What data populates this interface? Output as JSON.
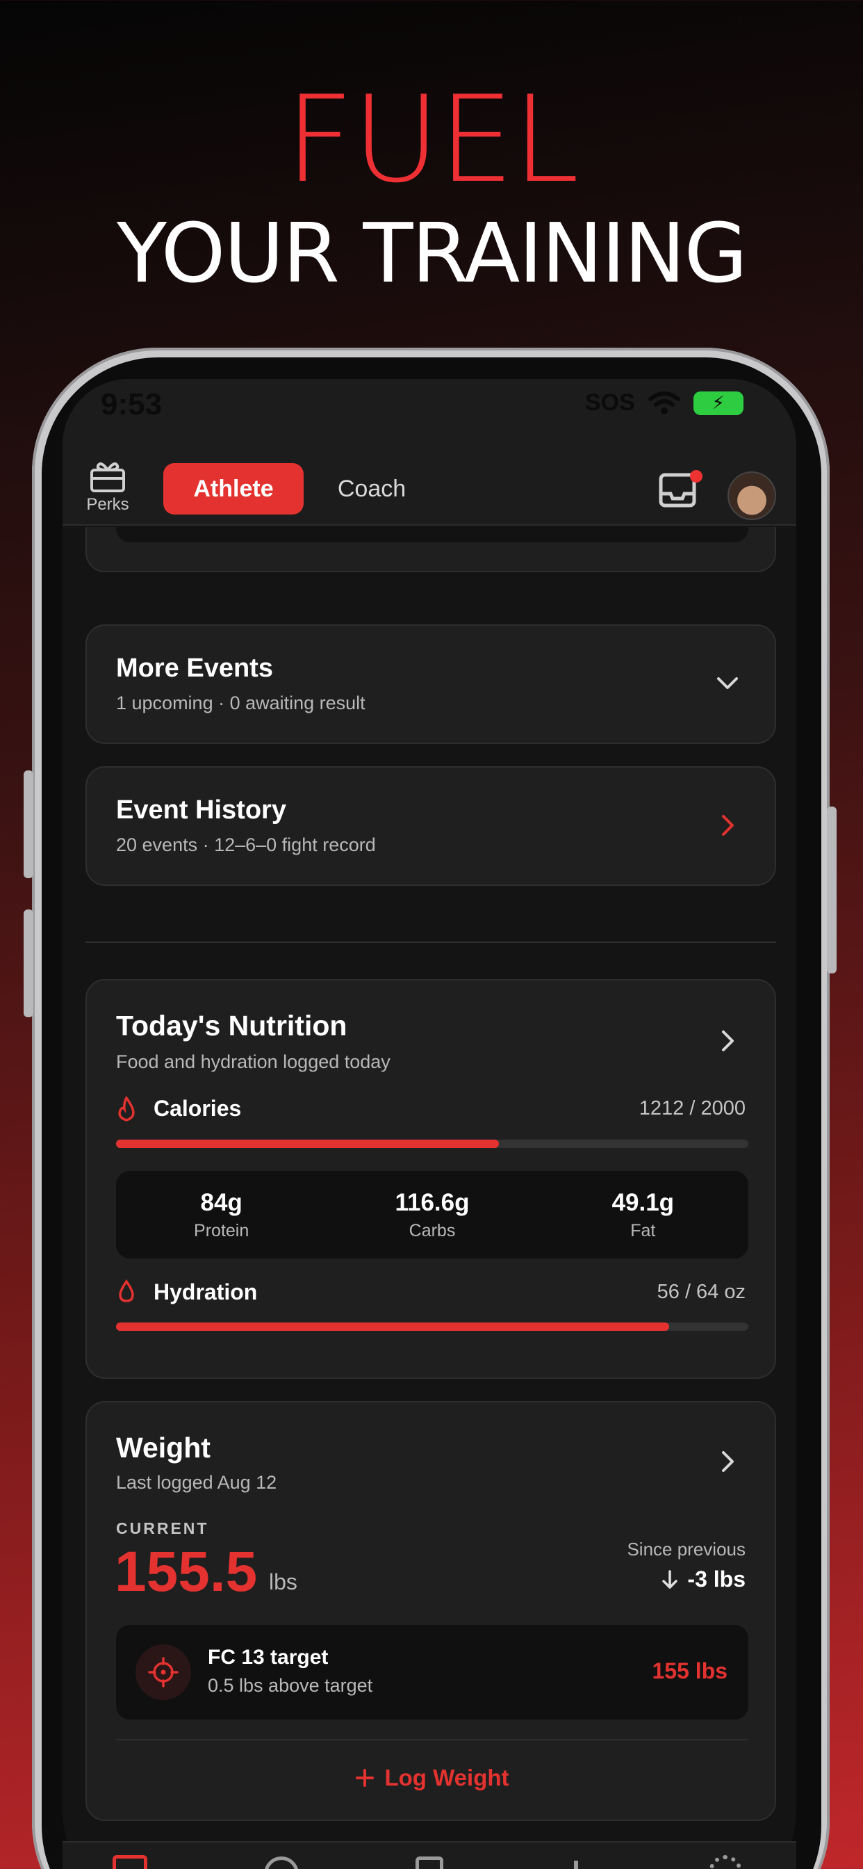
{
  "headline": {
    "line1": "FUEL",
    "line2": "YOUR TRAINING"
  },
  "status_bar": {
    "time": "9:53",
    "sos": "SOS"
  },
  "header": {
    "perks_label": "Perks",
    "tabs": [
      {
        "label": "Athlete",
        "active": true
      },
      {
        "label": "Coach",
        "active": false
      }
    ]
  },
  "more_events": {
    "title": "More Events",
    "subtitle": "1 upcoming · 0 awaiting result"
  },
  "event_history": {
    "title": "Event History",
    "subtitle": "20 events · 12–6–0 fight record"
  },
  "nutrition": {
    "title": "Today's Nutrition",
    "subtitle": "Food and hydration logged today",
    "calories": {
      "label": "Calories",
      "value": "1212 / 2000",
      "progress": 0.606
    },
    "macros": [
      {
        "value": "84g",
        "label": "Protein"
      },
      {
        "value": "116.6g",
        "label": "Carbs"
      },
      {
        "value": "49.1g",
        "label": "Fat"
      }
    ],
    "hydration": {
      "label": "Hydration",
      "value": "56 / 64 oz",
      "progress": 0.875
    }
  },
  "weight": {
    "title": "Weight",
    "subtitle": "Last logged Aug 12",
    "current_label": "CURRENT",
    "current_value": "155.5",
    "unit": "lbs",
    "since_label": "Since previous",
    "since_value": "-3 lbs",
    "target_title": "FC 13 target",
    "target_sub": "0.5 lbs above target",
    "target_value": "155 lbs",
    "log_button": "Log Weight"
  },
  "colors": {
    "accent": "#e3322f",
    "card": "#1f1f1f",
    "background": "#141414"
  }
}
